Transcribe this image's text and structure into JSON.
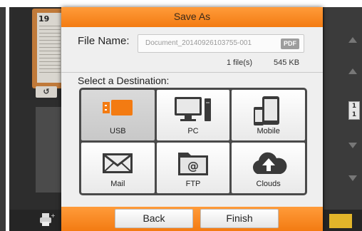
{
  "background": {
    "thumbnail_page_number": "19",
    "rotate_icon": "rotate-icon",
    "printer_icon": "printer-add-icon",
    "page_indicator": {
      "current": "1",
      "total": "1"
    }
  },
  "dialog": {
    "title": "Save As",
    "file_name_label": "File Name:",
    "file_name_value": "Document_20140926103755-001",
    "file_format": "PDF",
    "file_count": "1 file(s)",
    "file_size": "545 KB",
    "destination_label": "Select a Destination:",
    "destinations": [
      {
        "label": "USB",
        "icon": "usb-icon",
        "selected": true
      },
      {
        "label": "PC",
        "icon": "pc-icon",
        "selected": false
      },
      {
        "label": "Mobile",
        "icon": "mobile-icon",
        "selected": false
      },
      {
        "label": "Mail",
        "icon": "mail-icon",
        "selected": false
      },
      {
        "label": "FTP",
        "icon": "ftp-folder-icon",
        "selected": false
      },
      {
        "label": "Clouds",
        "icon": "cloud-upload-icon",
        "selected": false
      }
    ],
    "back_label": "Back",
    "finish_label": "Finish"
  },
  "colors": {
    "accent": "#f37b12",
    "usb": "#f37b12"
  }
}
